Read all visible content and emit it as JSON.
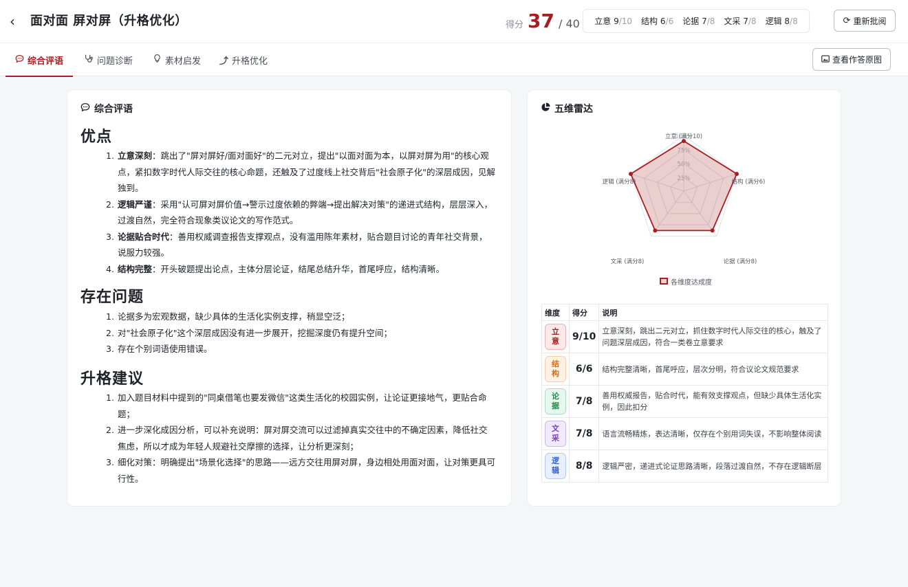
{
  "header": {
    "back_icon": "chevron-left-icon",
    "title": "面对面 屏对屏（升格优化）",
    "score_label": "得分",
    "score": "37",
    "score_total": "/ 40",
    "dims": [
      {
        "label": "立意",
        "score": "9",
        "max": "/10"
      },
      {
        "label": "结构",
        "score": "6",
        "max": "/6"
      },
      {
        "label": "论据",
        "score": "7",
        "max": "/8"
      },
      {
        "label": "文采",
        "score": "7",
        "max": "/8"
      },
      {
        "label": "逻辑",
        "score": "8",
        "max": "/8"
      }
    ],
    "rescore_label": "重新批阅",
    "view_label": "查看作答原图"
  },
  "tabs": [
    {
      "label": "综合评语",
      "icon": "comment-icon",
      "active": true
    },
    {
      "label": "问题诊断",
      "icon": "stethoscope-icon",
      "active": false
    },
    {
      "label": "素材启发",
      "icon": "lightbulb-icon",
      "active": false
    },
    {
      "label": "升格优化",
      "icon": "arrow-up-icon",
      "active": false
    }
  ],
  "comment": {
    "title": "综合评语",
    "strengths_title": "优点",
    "strengths": [
      {
        "n": "1.",
        "bold": "立意深刻",
        "text": "：跳出了\"屏对屏好/面对面好\"的二元对立，提出\"以面对面为本，以屏对屏为用\"的核心观点，紧扣数字时代人际交往的核心命题，还触及了过度线上社交背后\"社会原子化\"的深层成因，见解独到。"
      },
      {
        "n": "2.",
        "bold": "逻辑严谨",
        "text": "：采用\"认可屏对屏价值→警示过度依赖的弊端→提出解决对策\"的递进式结构，层层深入，过渡自然，完全符合现象类议论文的写作范式。"
      },
      {
        "n": "3.",
        "bold": "论据贴合时代",
        "text": "：善用权威调查报告支撑观点，没有滥用陈年素材，贴合题目讨论的青年社交背景，说服力较强。"
      },
      {
        "n": "4.",
        "bold": "结构完整",
        "text": "：开头破题提出论点，主体分层论证，结尾总结升华，首尾呼应，结构清晰。"
      }
    ],
    "problems_title": "存在问题",
    "problems": [
      {
        "n": "1.",
        "text": "论据多为宏观数据，缺少具体的生活化实例支撑，稍显空泛；"
      },
      {
        "n": "2.",
        "text": "对\"社会原子化\"这个深层成因没有进一步展开，挖掘深度仍有提升空间；"
      },
      {
        "n": "3.",
        "text": "存在个别词语使用错误。"
      }
    ],
    "suggest_title": "升格建议",
    "suggestions": [
      {
        "n": "1.",
        "text": "加入题目材料中提到的\"同桌借笔也要发微信\"这类生活化的校园实例，让论证更接地气，更贴合命题；"
      },
      {
        "n": "2.",
        "text": "进一步深化成因分析，可以补充说明：屏对屏交流可以过滤掉真实交往中的不确定因素，降低社交焦虑，所以才成为年轻人规避社交摩擦的选择，让分析更深刻；"
      },
      {
        "n": "3.",
        "text": "细化对策：明确提出\"场景化选择\"的思路——远方交往用屏对屏，身边相处用面对面，让对策更具可行性。"
      }
    ]
  },
  "radar": {
    "title": "五维雷达",
    "title_icon": "pie-chart-icon",
    "legend": "各维度达成度",
    "accent": "#a61e22",
    "chart_data": {
      "type": "radar",
      "axes": [
        "立意 (满分10)",
        "结构 (满分6)",
        "论据 (满分8)",
        "文采 (满分8)",
        "逻辑 (满分8)"
      ],
      "ticks": [
        "25%",
        "50%",
        "75%",
        "100%"
      ],
      "series": [
        {
          "name": "各维度达成度",
          "values": [
            90,
            100,
            87.5,
            87.5,
            100
          ]
        }
      ]
    }
  },
  "table": {
    "headers": [
      "维度",
      "得分",
      "说明"
    ],
    "rows": [
      {
        "dim": "立意",
        "score": "9/10",
        "desc": "立意深刻，跳出二元对立，抓住数字时代人际交往的核心，触及了问题深层成因，符合一类卷立意要求",
        "bg": "#fbe9ea",
        "fg": "#a61e22",
        "bd": "#e9b4b7"
      },
      {
        "dim": "结构",
        "score": "6/6",
        "desc": "结构完整清晰，首尾呼应，层次分明，符合议论文规范要求",
        "bg": "#fff1e3",
        "fg": "#d0701d",
        "bd": "#f6cfa6"
      },
      {
        "dim": "论据",
        "score": "7/8",
        "desc": "善用权威报告，贴合时代，能有效支撑观点，但缺少具体生活化实例，因此扣分",
        "bg": "#e6f7ee",
        "fg": "#1f8a4c",
        "bd": "#a9dfc0"
      },
      {
        "dim": "文采",
        "score": "7/8",
        "desc": "语言流畅精炼，表达清晰，仅存在个别用词失误，不影响整体阅读",
        "bg": "#f1eafb",
        "fg": "#7b3fc4",
        "bd": "#cdb5ee"
      },
      {
        "dim": "逻辑",
        "score": "8/8",
        "desc": "逻辑严密，递进式论证思路清晰，段落过渡自然，不存在逻辑断层",
        "bg": "#e9f0fd",
        "fg": "#2f64c9",
        "bd": "#b5c9f1"
      }
    ]
  }
}
